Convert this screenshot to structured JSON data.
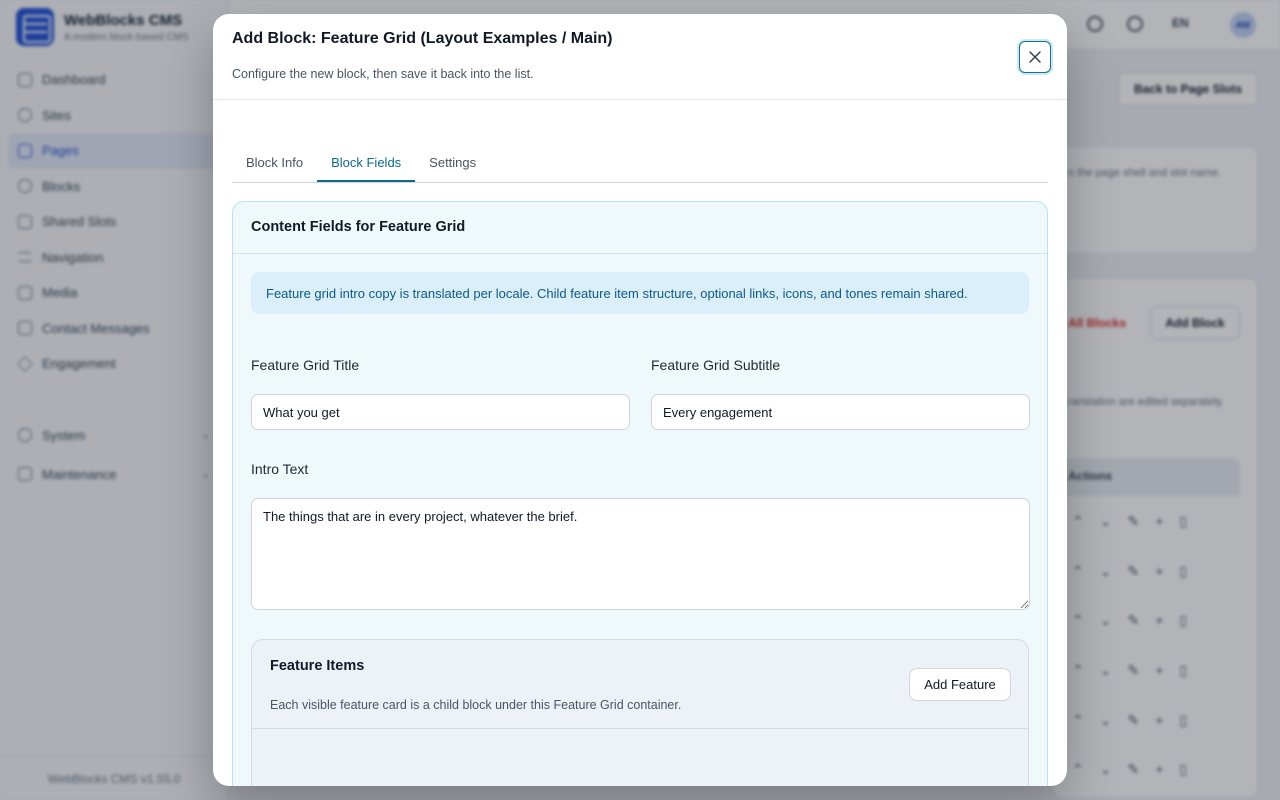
{
  "app": {
    "brand_name": "WebBlocks CMS",
    "brand_sub": "A modern block-based CMS",
    "version": "WebBlocks CMS v1.55.0",
    "nav": [
      {
        "label": "Dashboard",
        "icon": "dashboard-icon"
      },
      {
        "label": "Sites",
        "icon": "globe-icon"
      },
      {
        "label": "Pages",
        "icon": "page-icon",
        "active": true
      },
      {
        "label": "Blocks",
        "icon": "blocks-icon"
      },
      {
        "label": "Shared Slots",
        "icon": "layers-icon"
      },
      {
        "label": "Navigation",
        "icon": "menu-icon"
      },
      {
        "label": "Media",
        "icon": "image-icon"
      },
      {
        "label": "Contact Messages",
        "icon": "mail-icon"
      },
      {
        "label": "Engagement",
        "icon": "star-icon"
      }
    ],
    "nav_groups": [
      {
        "label": "System",
        "icon": "gear-icon"
      },
      {
        "label": "Maintenance",
        "icon": "wrench-icon"
      }
    ],
    "topbar": {
      "lang": "EN",
      "avatar": "AW"
    },
    "back_button": "Back to Page Slots",
    "slot_hint": "n the page shell and slot name.",
    "all_blocks": "All Blocks",
    "add_block": "Add Block",
    "translation_hint": "ranslation are edited separately.",
    "actions_header": "Actions"
  },
  "modal": {
    "title": "Add Block: Feature Grid (Layout Examples / Main)",
    "subtitle": "Configure the new block, then save it back into the list.",
    "tabs": [
      {
        "label": "Block Info",
        "active": false
      },
      {
        "label": "Block Fields",
        "active": true
      },
      {
        "label": "Settings",
        "active": false
      }
    ],
    "panel": {
      "title": "Content Fields for Feature Grid",
      "alert": "Feature grid intro copy is translated per locale. Child feature item structure, optional links, icons, and tones remain shared.",
      "feature_grid_title": {
        "label": "Feature Grid Title",
        "value": "What you get"
      },
      "feature_grid_subtitle": {
        "label": "Feature Grid Subtitle",
        "value": "Every engagement"
      },
      "intro_text": {
        "label": "Intro Text",
        "value": "The things that are in every project, whatever the brief."
      },
      "feature_items": {
        "title": "Feature Items",
        "description": "Each visible feature card is a child block under this Feature Grid container.",
        "add_button": "Add Feature"
      }
    }
  },
  "colors": {
    "accent": "#0e6a8f",
    "panel_bg": "#eff9fc",
    "alert_bg": "#dbeefc",
    "danger": "#dc2626"
  }
}
